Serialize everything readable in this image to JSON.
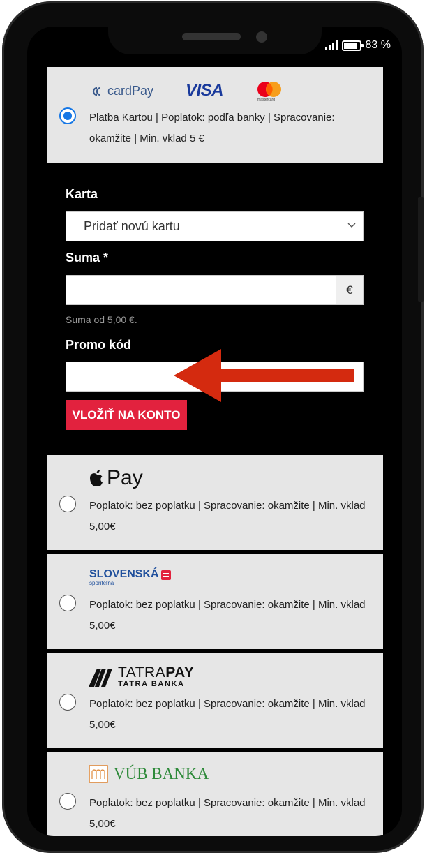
{
  "status_bar": {
    "battery": "83 %"
  },
  "card_method": {
    "cardpay_logo": "cardPay",
    "visa_logo": "VISA",
    "mastercard_logo": "mastercard",
    "description": "Platba Kartou | Poplatok: podľa banky | Spracovanie: okamžite | Min. vklad 5 €",
    "selected": true
  },
  "form": {
    "card_label": "Karta",
    "card_select_value": "Pridať novú kartu",
    "amount_label": "Suma *",
    "amount_value": "",
    "currency_addon": "€",
    "amount_hint": "Suma od 5,00 €.",
    "promo_label": "Promo kód",
    "promo_value": "",
    "deposit_button": "VLOŽIŤ NA KONTO"
  },
  "methods": [
    {
      "logo": "Pay",
      "description": "Poplatok: bez poplatku | Spracovanie: okamžite | Min. vklad 5,00€",
      "selected": false
    },
    {
      "logo": "SLOVENSKÁ",
      "logo_sub": "sporiteľňa",
      "description": "Poplatok: bez poplatku | Spracovanie: okamžite | Min. vklad 5,00€",
      "selected": false
    },
    {
      "logo": "TATRA",
      "logo_bold": "PAY",
      "logo_sub": "TATRA BANKA",
      "description": "Poplatok: bez poplatku | Spracovanie: okamžite | Min. vklad 5,00€",
      "selected": false
    },
    {
      "logo": "VÚB BANKA",
      "description": "Poplatok: bez poplatku | Spracovanie: okamžite | Min. vklad 5,00€",
      "selected": false
    }
  ],
  "colors": {
    "accent_red": "#e2223e",
    "radio_blue": "#1677e5",
    "arrow_red": "#d42a0f",
    "card_bg": "#e6e6e6"
  }
}
